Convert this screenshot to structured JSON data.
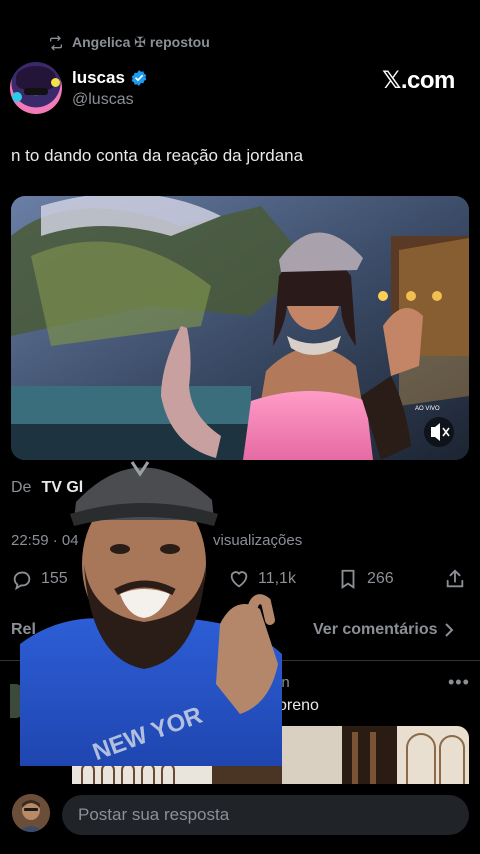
{
  "repost": {
    "text": "Angelica ✠ repostou",
    "icon": "repost-icon"
  },
  "tweet": {
    "display_name": "luscas",
    "handle": "@luscas",
    "verified_icon": "verified-badge-icon",
    "text": "n to dando conta da reação da jordana",
    "source_prefix": "De",
    "source_name": "TV Gl",
    "time": "22:59 · 04",
    "views": "visualizações"
  },
  "watermark": {
    "brand": "𝕏.com"
  },
  "media": {
    "badge_live": "AO VIVO",
    "mute_icon": "mute-icon"
  },
  "actions": {
    "reply_count": "155",
    "like_count": "11,1k",
    "bookmark_count": "266"
  },
  "related": {
    "label": "Rel",
    "more_comments": "Ver comentários"
  },
  "reply": {
    "name_fragment": "in",
    "text_fragment": "oreno",
    "more": "•••"
  },
  "compose": {
    "placeholder": "Postar sua resposta"
  },
  "colors": {
    "background": "#000000",
    "muted_text": "#8b9097",
    "verified": "#1d9bf0",
    "input_bg": "#202327"
  }
}
